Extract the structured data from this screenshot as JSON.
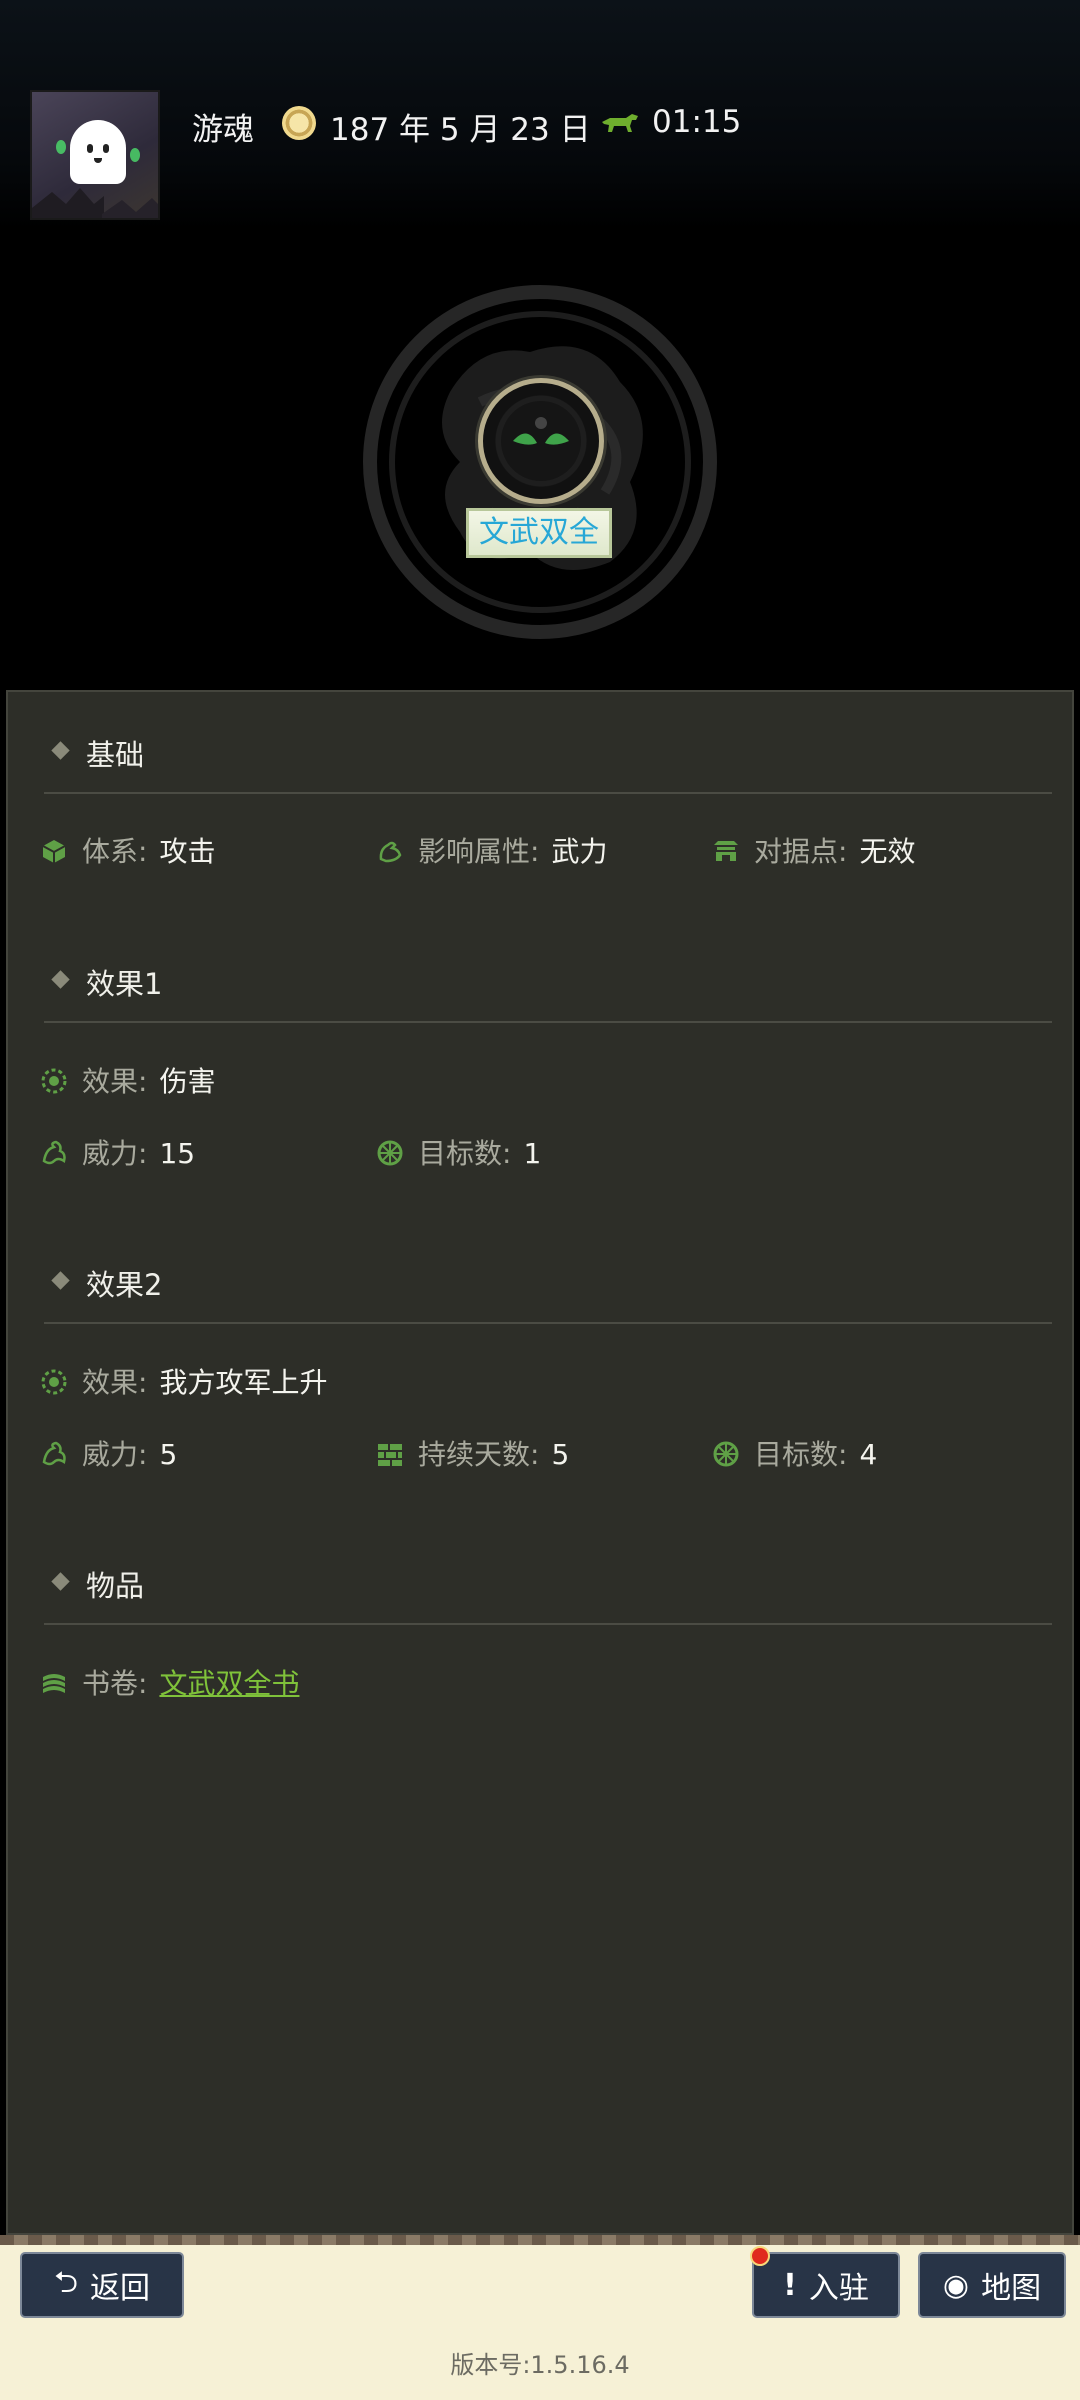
{
  "header": {
    "user_name": "游魂",
    "date": "187 年 5 月 23 日",
    "time": "01:15"
  },
  "skill": {
    "title": "文武双全"
  },
  "sections": [
    {
      "title": "基础",
      "rows": [
        {
          "icon": "cube-icon",
          "label": "体系",
          "value": "攻击"
        },
        {
          "icon": "arm-icon",
          "label": "影响属性",
          "value": "武力"
        },
        {
          "icon": "gate-icon",
          "label": "对据点",
          "value": "无效"
        }
      ]
    },
    {
      "title": "效果1",
      "rows": [
        {
          "icon": "effect-gear-icon",
          "label": "效果",
          "value": "伤害"
        },
        {
          "icon": "dragon-icon",
          "label": "威力",
          "value": "15"
        },
        {
          "icon": "target-icon",
          "label": "目标数",
          "value": "1"
        }
      ]
    },
    {
      "title": "效果2",
      "rows": [
        {
          "icon": "effect-gear-icon",
          "label": "效果",
          "value": "我方攻军上升"
        },
        {
          "icon": "dragon-icon",
          "label": "威力",
          "value": "5"
        },
        {
          "icon": "wall-icon",
          "label": "持续天数",
          "value": "5"
        },
        {
          "icon": "target-icon",
          "label": "目标数",
          "value": "4"
        }
      ]
    },
    {
      "title": "物品",
      "rows": [
        {
          "icon": "scroll-icon",
          "label": "书卷",
          "value": "文武双全书"
        }
      ]
    }
  ],
  "footer": {
    "back_label": "返回",
    "settle_label": "入驻",
    "map_label": "地图",
    "version": "版本号:1.5.16.4"
  },
  "colors": {
    "panel_bg": "#2d2e28",
    "accent_green": "#7fc23a",
    "skill_title_text": "#27a7d6",
    "button_bg": "#283447",
    "footer_bg": "#f6f1d6"
  }
}
